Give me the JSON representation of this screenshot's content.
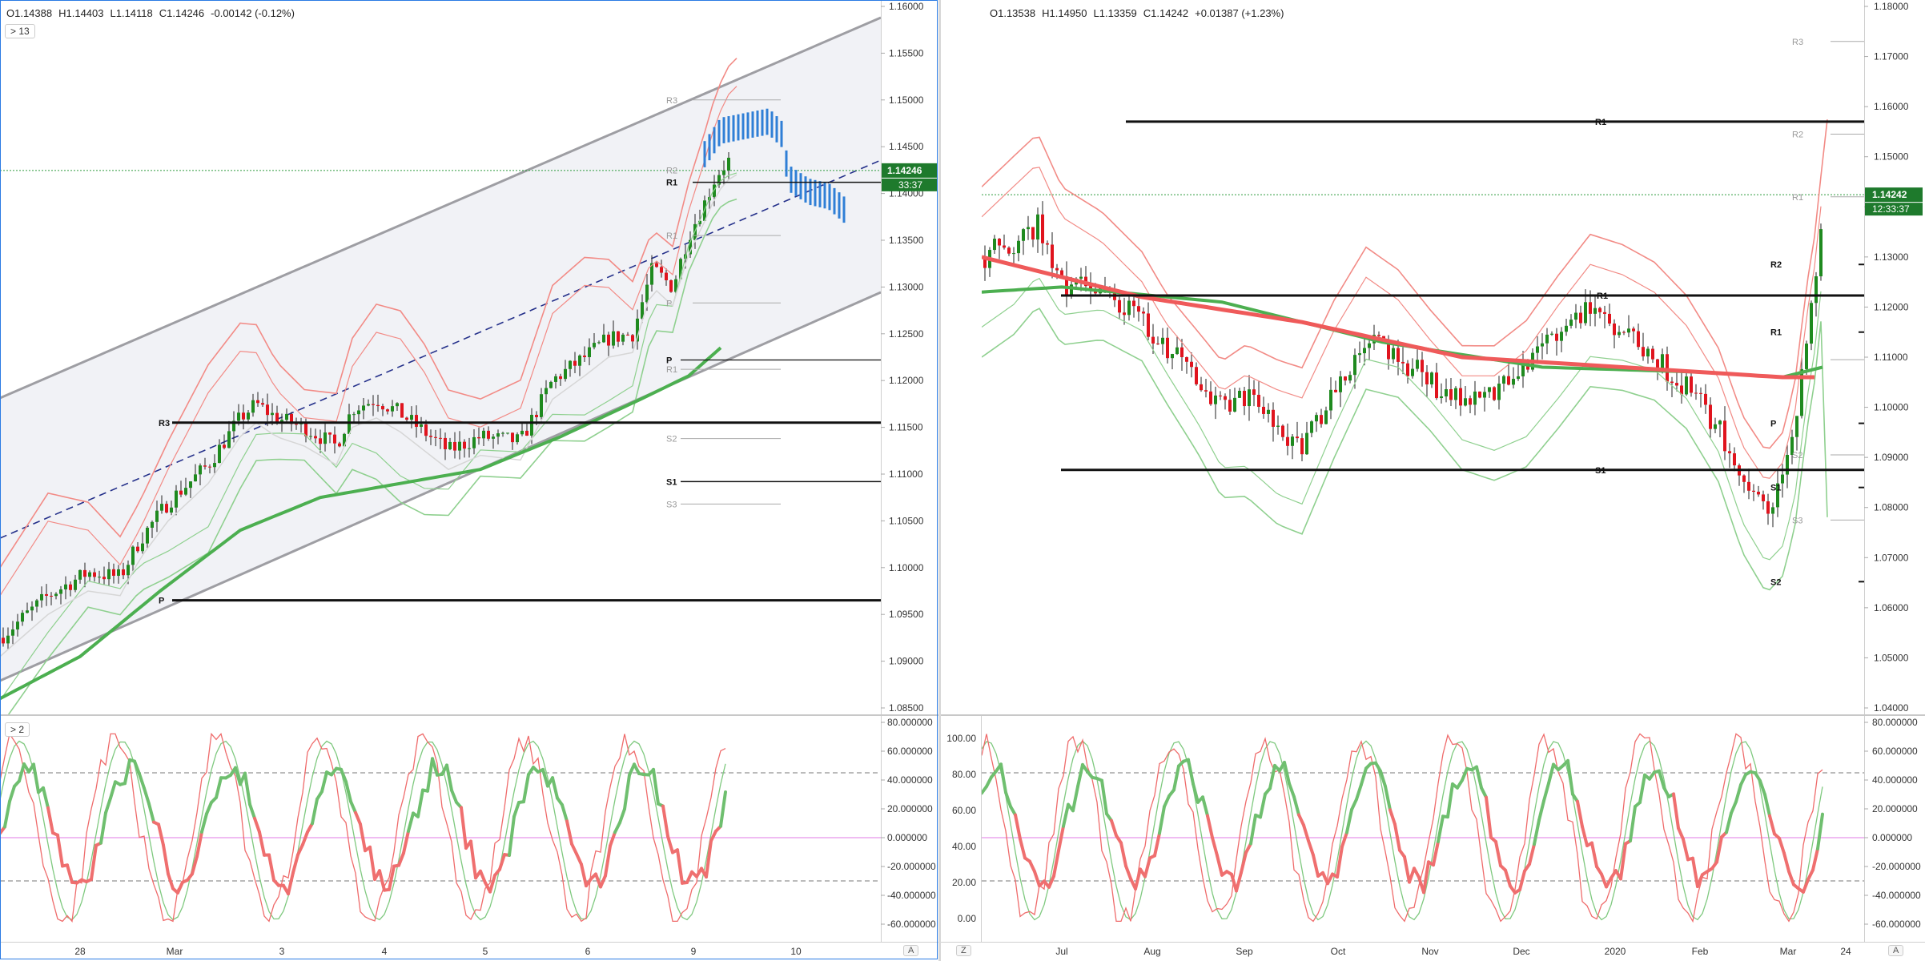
{
  "left_chart": {
    "legend": {
      "o": "O1.14388",
      "h": "H1.14403",
      "l": "L1.14118",
      "c": "C1.14246",
      "chg": "-0.00142 (-0.12%)"
    },
    "collapse_label": "> 13",
    "osc_collapse_label": "> 2",
    "price_tag": "1.14246",
    "countdown_tag": "33:37",
    "auto_label": "A",
    "price_axis": [
      "1.16000",
      "1.15500",
      "1.15000",
      "1.14500",
      "1.14000",
      "1.13500",
      "1.13000",
      "1.12500",
      "1.12000",
      "1.11500",
      "1.11000",
      "1.10500",
      "1.10000",
      "1.09500",
      "1.09000",
      "1.08500"
    ],
    "osc_axis": [
      "80.000000",
      "60.000000",
      "40.000000",
      "20.000000",
      "0.000000",
      "-20.000000",
      "-40.000000",
      "-60.000000"
    ],
    "time_axis": [
      "28",
      "Mar",
      "3",
      "4",
      "5",
      "6",
      "9",
      "10"
    ],
    "pivot_labels": [
      "R3",
      "R2",
      "R1",
      "R1",
      "P",
      "P",
      "P",
      "R1",
      "S2",
      "S1",
      "S3",
      "R1",
      "P"
    ]
  },
  "right_chart": {
    "legend": {
      "o": "O1.13538",
      "h": "H1.14950",
      "l": "L1.13359",
      "c": "C1.14242",
      "chg": "+0.01387 (+1.23%)"
    },
    "price_tag": "1.14242",
    "countdown_tag": "12:33:37",
    "auto_label": "A",
    "z_label": "Z",
    "price_axis": [
      "1.18000",
      "1.17000",
      "1.16000",
      "1.15000",
      "1.14000",
      "1.13000",
      "1.12000",
      "1.11000",
      "1.10000",
      "1.09000",
      "1.08000",
      "1.07000",
      "1.06000",
      "1.05000",
      "1.04000"
    ],
    "osc_left_axis": [
      "100.00",
      "80.00",
      "60.00",
      "40.00",
      "20.00",
      "0.00"
    ],
    "osc_right_axis": [
      "80.000000",
      "60.000000",
      "40.000000",
      "20.000000",
      "0.000000",
      "-20.000000",
      "-40.000000",
      "-60.000000"
    ],
    "time_axis": [
      "Jul",
      "Aug",
      "Sep",
      "Oct",
      "Nov",
      "Dec",
      "2020",
      "Feb",
      "Mar",
      "24"
    ],
    "pivot_labels": [
      "R3",
      "R1",
      "R2",
      "R1",
      "R2",
      "R1",
      "P",
      "S2",
      "S1",
      "S1",
      "S3",
      "S2",
      "R1",
      "R1"
    ]
  },
  "colors": {
    "up": "#1f8a1f",
    "down": "#e0141e",
    "forecast": "#2f7fd6",
    "bb_red": "#f28b86",
    "bb_green": "#8fd08f",
    "ma_red": "#ef5a5a",
    "ma_green": "#4caf50",
    "channel": "#9e9ea3",
    "pivot": "#111111",
    "price_tag_bg": "#1e7a2c",
    "osc_magenta": "#e27ae6"
  },
  "chart_data": [
    {
      "type": "candlestick",
      "title": "",
      "timeframe_ticks": [
        "28",
        "Mar",
        "3",
        "4",
        "5",
        "6",
        "9",
        "10"
      ],
      "ylim": [
        1.085,
        1.16
      ],
      "last": 1.14246,
      "ohlc_last": {
        "open": 1.14388,
        "high": 1.14403,
        "low": 1.14118,
        "close": 1.14246
      },
      "close_path": [
        {
          "x": "Feb 27",
          "y": 1.093
        },
        {
          "x": "Feb 28",
          "y": 1.099
        },
        {
          "x": "Mar 2",
          "y": 1.105
        },
        {
          "x": "Mar 2 late",
          "y": 1.117
        },
        {
          "x": "Mar 3",
          "y": 1.114
        },
        {
          "x": "Mar 3 late",
          "y": 1.1175
        },
        {
          "x": "Mar 4",
          "y": 1.116
        },
        {
          "x": "Mar 4 late",
          "y": 1.114
        },
        {
          "x": "Mar 5",
          "y": 1.1125
        },
        {
          "x": "Mar 5 late",
          "y": 1.12
        },
        {
          "x": "Mar 6",
          "y": 1.1235
        },
        {
          "x": "Mar 6 late",
          "y": 1.133
        },
        {
          "x": "Mar 9",
          "y": 1.14
        },
        {
          "x": "Mar 9 late",
          "y": 1.1465
        },
        {
          "x": "Mar 10",
          "y": 1.142
        }
      ],
      "oscillator": {
        "ylim": [
          -60,
          80
        ],
        "levels": [
          45,
          0,
          -30
        ]
      }
    },
    {
      "type": "candlestick",
      "title": "",
      "timeframe_ticks": [
        "Jul",
        "Aug",
        "Sep",
        "Oct",
        "Nov",
        "Dec",
        "2020",
        "Feb",
        "Mar",
        "24"
      ],
      "ylim": [
        1.04,
        1.18
      ],
      "last": 1.14242,
      "ohlc_last": {
        "open": 1.13538,
        "high": 1.1495,
        "low": 1.13359,
        "close": 1.14242
      },
      "close_path": [
        {
          "x": "Jun",
          "y": 1.13
        },
        {
          "x": "Jul",
          "y": 1.134
        },
        {
          "x": "Jul late",
          "y": 1.122
        },
        {
          "x": "Aug",
          "y": 1.12
        },
        {
          "x": "Aug late",
          "y": 1.108
        },
        {
          "x": "Sep",
          "y": 1.1
        },
        {
          "x": "Sep late",
          "y": 1.095
        },
        {
          "x": "Oct",
          "y": 1.092
        },
        {
          "x": "Oct late",
          "y": 1.115
        },
        {
          "x": "Nov",
          "y": 1.108
        },
        {
          "x": "Nov late",
          "y": 1.1
        },
        {
          "x": "Dec",
          "y": 1.108
        },
        {
          "x": "Dec late",
          "y": 1.12
        },
        {
          "x": "2020",
          "y": 1.12
        },
        {
          "x": "Jan late",
          "y": 1.105
        },
        {
          "x": "Feb",
          "y": 1.09
        },
        {
          "x": "Feb late",
          "y": 1.08
        },
        {
          "x": "Mar",
          "y": 1.12
        },
        {
          "x": "Mar late",
          "y": 1.1424
        }
      ],
      "oscillator": {
        "ylim": [
          -60,
          80
        ],
        "levels": [
          45,
          0,
          -30
        ]
      }
    }
  ]
}
